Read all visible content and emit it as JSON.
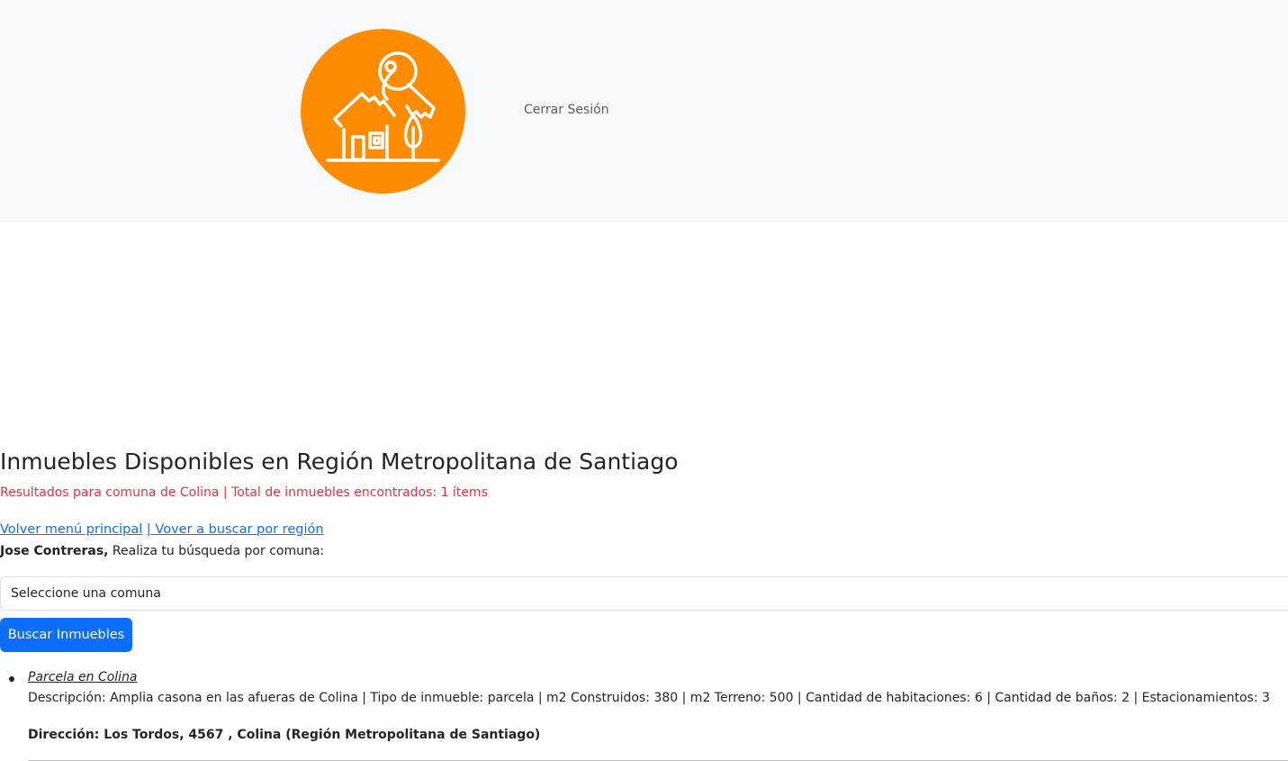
{
  "nav": {
    "logo_icon": "house-key-icon",
    "logout_label": "Cerrar Sesión"
  },
  "colors": {
    "logo_bg": "#ff8c00",
    "results_text": "#dc3545",
    "link": "#0d6efd",
    "primary_button": "#0d6efd"
  },
  "page": {
    "title": "Inmuebles Disponibles en Región Metropolitana de Santiago",
    "results": "Resultados para comuna de Colina | Total de inmuebles encontrados: 1 ítems",
    "link_main_menu": "Volver menú principal",
    "link_search_region": "| Vover a buscar por región",
    "user_name": "Jose Contreras,",
    "search_prompt": " Realiza tu búsqueda por comuna:",
    "select_value": "Seleccione una comuna",
    "search_button": "Buscar Inmuebles"
  },
  "listings": [
    {
      "title": "Parcela en Colina",
      "description": "Descripción: Amplia casona en las afueras de Colina | Tipo de inmueble: parcela | m2 Construidos: 380 | m2 Terreno: 500 | Cantidad de habitaciones: 6 | Cantidad de baños: 2 | Estacionamientos: 3",
      "address": "Dirección: Los Tordos, 4567 , Colina (Región Metropolitana de Santiago)"
    }
  ]
}
